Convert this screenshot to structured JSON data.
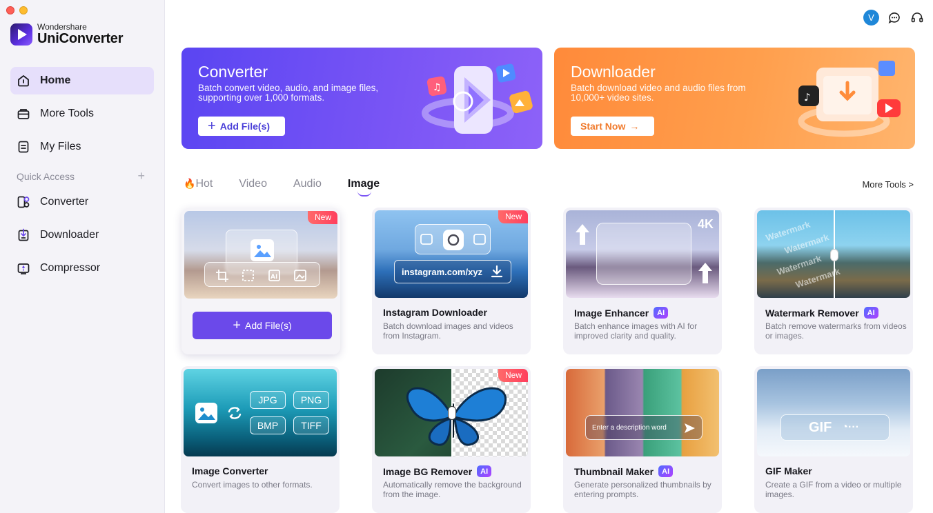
{
  "brand": {
    "top": "Wondershare",
    "name": "UniConverter"
  },
  "sidebar": {
    "items": [
      {
        "label": "Home",
        "icon": "home-icon"
      },
      {
        "label": "More Tools",
        "icon": "toolbox-icon"
      },
      {
        "label": "My Files",
        "icon": "file-icon"
      }
    ],
    "quick_access_label": "Quick Access",
    "quick_items": [
      {
        "label": "Converter",
        "icon": "converter-icon"
      },
      {
        "label": "Downloader",
        "icon": "downloader-icon"
      },
      {
        "label": "Compressor",
        "icon": "compressor-icon"
      }
    ]
  },
  "topbar": {
    "avatar_letter": "V"
  },
  "banners": {
    "converter": {
      "title": "Converter",
      "desc": "Batch convert video, audio, and image files, supporting over 1,000 formats.",
      "button": "Add File(s)"
    },
    "downloader": {
      "title": "Downloader",
      "desc": "Batch download video and audio files from 10,000+ video sites.",
      "button": "Start Now"
    }
  },
  "tabs": {
    "hot": "Hot",
    "video": "Video",
    "audio": "Audio",
    "image": "Image",
    "more_tools": "More Tools >"
  },
  "badges": {
    "new": "New",
    "ai": "AI"
  },
  "cards": {
    "featured": {
      "button": "Add File(s)"
    },
    "instagram": {
      "title": "Instagram Downloader",
      "desc": "Batch download images and videos from Instagram.",
      "url": "instagram.com/xyz"
    },
    "enhancer": {
      "title": "Image Enhancer",
      "desc": "Batch enhance images with AI for improved clarity and quality.",
      "res": "4K"
    },
    "watermark": {
      "title": "Watermark Remover",
      "desc": "Batch remove watermarks from videos or images.",
      "wm": "Watermark"
    },
    "converter": {
      "title": "Image Converter",
      "desc": "Convert images to other formats.",
      "formats": [
        "JPG",
        "PNG",
        "BMP",
        "TIFF"
      ]
    },
    "bgremover": {
      "title": "Image BG Remover",
      "desc": "Automatically remove the background from the image."
    },
    "thumbnail": {
      "title": "Thumbnail Maker",
      "desc": "Generate personalized thumbnails by entering prompts.",
      "prompt": "Enter a description word"
    },
    "gif": {
      "title": "GIF Maker",
      "desc": "Create a GIF from a video or multiple images.",
      "label": "GIF"
    }
  }
}
